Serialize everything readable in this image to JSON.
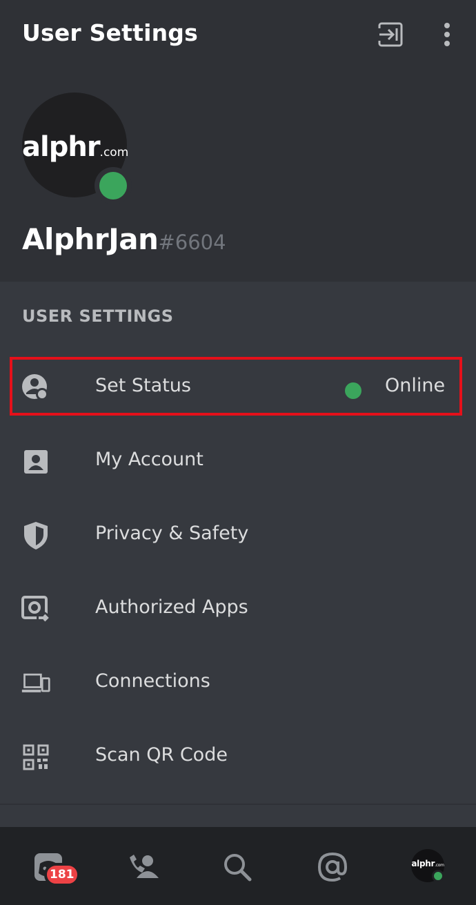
{
  "header": {
    "title": "User Settings",
    "logout_icon": "logout-icon",
    "more_icon": "more-vertical-icon"
  },
  "profile": {
    "avatar_logo": "alphr",
    "avatar_logo_suffix": ".com",
    "username": "AlphrJan",
    "discriminator": "#6604",
    "status_color": "#3ba55c"
  },
  "section": {
    "label": "USER SETTINGS"
  },
  "menu": [
    {
      "label": "Set Status",
      "icon": "status-icon",
      "value": "Online"
    },
    {
      "label": "My Account",
      "icon": "account-icon"
    },
    {
      "label": "Privacy & Safety",
      "icon": "shield-icon"
    },
    {
      "label": "Authorized Apps",
      "icon": "authorized-apps-icon"
    },
    {
      "label": "Connections",
      "icon": "devices-icon"
    },
    {
      "label": "Scan QR Code",
      "icon": "qr-code-icon"
    }
  ],
  "bottom_nav": {
    "home_badge": "181",
    "items": [
      "home-icon",
      "friends-icon",
      "search-icon",
      "mentions-icon",
      "profile-avatar"
    ],
    "avatar_logo": "alphr",
    "avatar_logo_suffix": ".com"
  },
  "colors": {
    "background": "#36393f",
    "header_bg": "#2f3136",
    "nav_bg": "#202225",
    "online": "#3ba55c",
    "highlight": "#e5101a",
    "badge": "#ed4245"
  }
}
